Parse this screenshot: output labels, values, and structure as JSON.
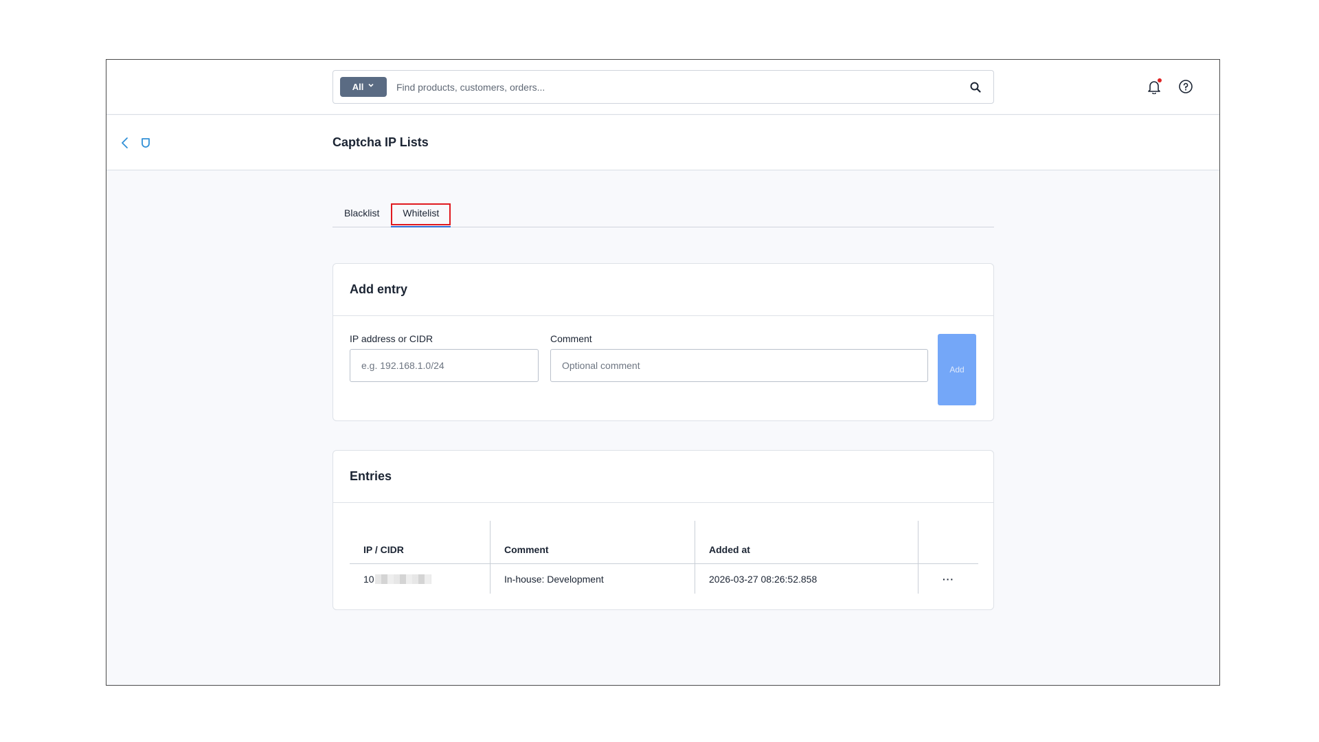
{
  "topbar": {
    "search": {
      "scope_label": "All",
      "placeholder": "Find products, customers, orders...",
      "value": ""
    },
    "icons": [
      "search-icon",
      "bell-icon",
      "help-icon"
    ]
  },
  "page": {
    "title": "Captcha IP Lists"
  },
  "tabs": [
    {
      "label": "Blacklist",
      "active": false
    },
    {
      "label": "Whitelist",
      "active": true
    }
  ],
  "add_entry": {
    "title": "Add entry",
    "ip_label": "IP address or CIDR",
    "ip_placeholder": "e.g. 192.168.1.0/24",
    "comment_label": "Comment",
    "comment_placeholder": "Optional comment",
    "add_label": "Add"
  },
  "entries": {
    "title": "Entries",
    "columns": [
      "IP / CIDR",
      "Comment",
      "Added at",
      ""
    ],
    "rows": [
      {
        "ip": "10",
        "comment": "In-house: Development",
        "added_at": "2026-03-27 08:26:52.858",
        "actions": "···"
      }
    ]
  },
  "colors": {
    "accent": "#2f6fd6",
    "add_button": "#74a7f8",
    "highlight": "#e0191f",
    "notification_dot": "#e02424"
  }
}
